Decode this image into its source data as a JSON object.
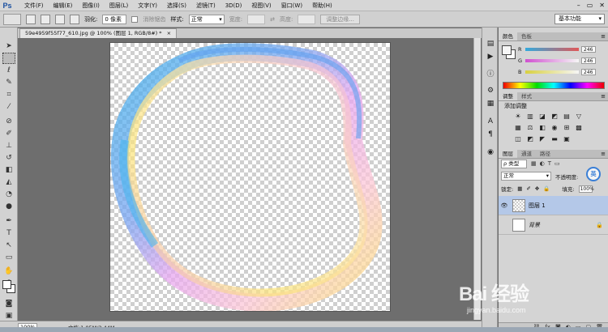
{
  "app": {
    "logo": "Ps"
  },
  "menu": [
    "文件(F)",
    "编辑(E)",
    "图像(I)",
    "图层(L)",
    "文字(Y)",
    "选择(S)",
    "滤镜(T)",
    "3D(D)",
    "视图(V)",
    "窗口(W)",
    "帮助(H)"
  ],
  "window_controls": {
    "minimize": "–",
    "restore": "▭",
    "close": "✕"
  },
  "options": {
    "feather_label": "羽化:",
    "feather_value": "0 像素",
    "antialias_label": "消除锯齿",
    "style_label": "样式:",
    "style_value": "正常",
    "width_label": "宽度:",
    "height_label": "高度:",
    "refine_edge": "调整边缘...",
    "workspace": "基本功能"
  },
  "document": {
    "tab_title": "59e4959f55f77_610.jpg @ 100% (图层 1, RGB/8#) *",
    "close": "×",
    "zoom": "100%",
    "info": "文档:1.05M/2.44M"
  },
  "color_panel": {
    "tabs": [
      "颜色",
      "色板"
    ],
    "r_label": "R",
    "g_label": "G",
    "b_label": "B",
    "r_value": "246",
    "g_value": "246",
    "b_value": "246",
    "r_color": "#e05858",
    "g_color": "#d050d0",
    "b_color": "#d8d040"
  },
  "adjust_panel": {
    "tabs": [
      "调整",
      "样式"
    ],
    "title": "添加调整",
    "icons": [
      "☀",
      "▥",
      "◪",
      "◩",
      "▤",
      "▽",
      "",
      "▦",
      "⚖",
      "◧",
      "◉",
      "⊞",
      "▩",
      "",
      "◫",
      "◩",
      "◤",
      "▬",
      "▣",
      "",
      ""
    ]
  },
  "layers_panel": {
    "tabs": [
      "图层",
      "通道",
      "路径"
    ],
    "search": "ρ 类型",
    "blend_mode": "正常",
    "opacity_label": "不透明度:",
    "lock_label": "锁定:",
    "fill_label": "填充:",
    "fill_value": "100%",
    "layers": [
      {
        "name": "图层 1",
        "visible_icon": "👁",
        "selected": true
      },
      {
        "name": "背景",
        "visible_icon": "",
        "selected": false,
        "lock": "🔒"
      }
    ],
    "badge": "英"
  },
  "watermark": {
    "logo": "Bai 经验",
    "url": "jingyan.baidu.com"
  },
  "colors": {
    "accent": "#3a7fd6",
    "selection": "#b4c8e8"
  }
}
